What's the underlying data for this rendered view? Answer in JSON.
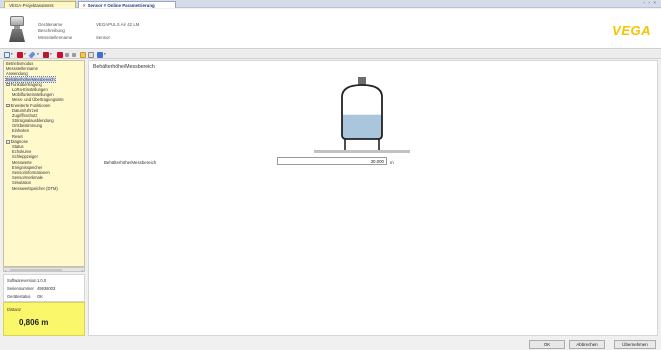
{
  "tabs": [
    {
      "label": "VEGA-Projektassistent"
    },
    {
      "label": "Sensor # Online Parametrierung",
      "close": "×"
    }
  ],
  "window_controls": "‹ › ×",
  "header": {
    "labels": [
      "Gerätename",
      "Beschreibung",
      "Messstellenname"
    ],
    "values": [
      "VEGAPULS Air 42 LM",
      "",
      "Sensor"
    ],
    "logo": "VEGA"
  },
  "toolbar": {
    "buttons": [
      "new-icon",
      "upload-icon",
      "tool-icon",
      "flag-icon",
      "download-icon",
      "stop-icon",
      "pause-icon",
      "folder-icon",
      "edit-icon",
      "help-icon"
    ],
    "accent_color": "#c8102e"
  },
  "sidebar": {
    "items": [
      {
        "label": "Betriebsmodus",
        "level": 0
      },
      {
        "label": "Messstellenname",
        "level": 0
      },
      {
        "label": "Anwendung",
        "level": 0
      },
      {
        "label": "Behälterhöhe/Messbereich",
        "level": 0,
        "selected": true
      },
      {
        "label": "Funkübertragung",
        "level": 0,
        "expander": "−"
      },
      {
        "label": "LoRa-Einstellungen",
        "level": 1
      },
      {
        "label": "Mobilfunkeinstellungen",
        "level": 1
      },
      {
        "label": "Mess- und Übertragungsinte",
        "level": 1
      },
      {
        "label": "Erweiterte Funktionen",
        "level": 0,
        "expander": "−"
      },
      {
        "label": "Datum/Uhrzeit",
        "level": 1
      },
      {
        "label": "Zugriffsschutz",
        "level": 1
      },
      {
        "label": "Störsignalausblendung",
        "level": 1
      },
      {
        "label": "Ortsbestimmung",
        "level": 1
      },
      {
        "label": "Einheiten",
        "level": 1
      },
      {
        "label": "Reset",
        "level": 1
      },
      {
        "label": "Diagnose",
        "level": 0,
        "expander": "−"
      },
      {
        "label": "Status",
        "level": 1
      },
      {
        "label": "Echokurve",
        "level": 1
      },
      {
        "label": "Schleppzeiger",
        "level": 1
      },
      {
        "label": "Messwerte",
        "level": 1
      },
      {
        "label": "Ereignisspeicher",
        "level": 1
      },
      {
        "label": "Sensorinformationen",
        "level": 1
      },
      {
        "label": "Sensormerkmale",
        "level": 1
      },
      {
        "label": "Simulation",
        "level": 1
      },
      {
        "label": "Messwertspeicher (DTM)",
        "level": 1
      }
    ],
    "scroll_left": "‹",
    "scroll_right": "›"
  },
  "info": {
    "rows": [
      {
        "label": "Softwareversion",
        "value": "1.0.0"
      },
      {
        "label": "Seriennummer",
        "value": "49936003"
      },
      {
        "label": "Gerätestatus",
        "value": "OK"
      }
    ]
  },
  "distance": {
    "label": "Distanz",
    "value": "0,806 m",
    "color": "#fbf76a"
  },
  "main": {
    "title": "Behälterhöhe/Messbereich",
    "field_label": "Behälterhöhe/Messbereich",
    "field_value": "30.000",
    "field_unit": "m",
    "fill_level": 0.45
  },
  "buttons": {
    "ok": "OK",
    "cancel": "Abbrechen",
    "apply": "Übernehmen"
  }
}
